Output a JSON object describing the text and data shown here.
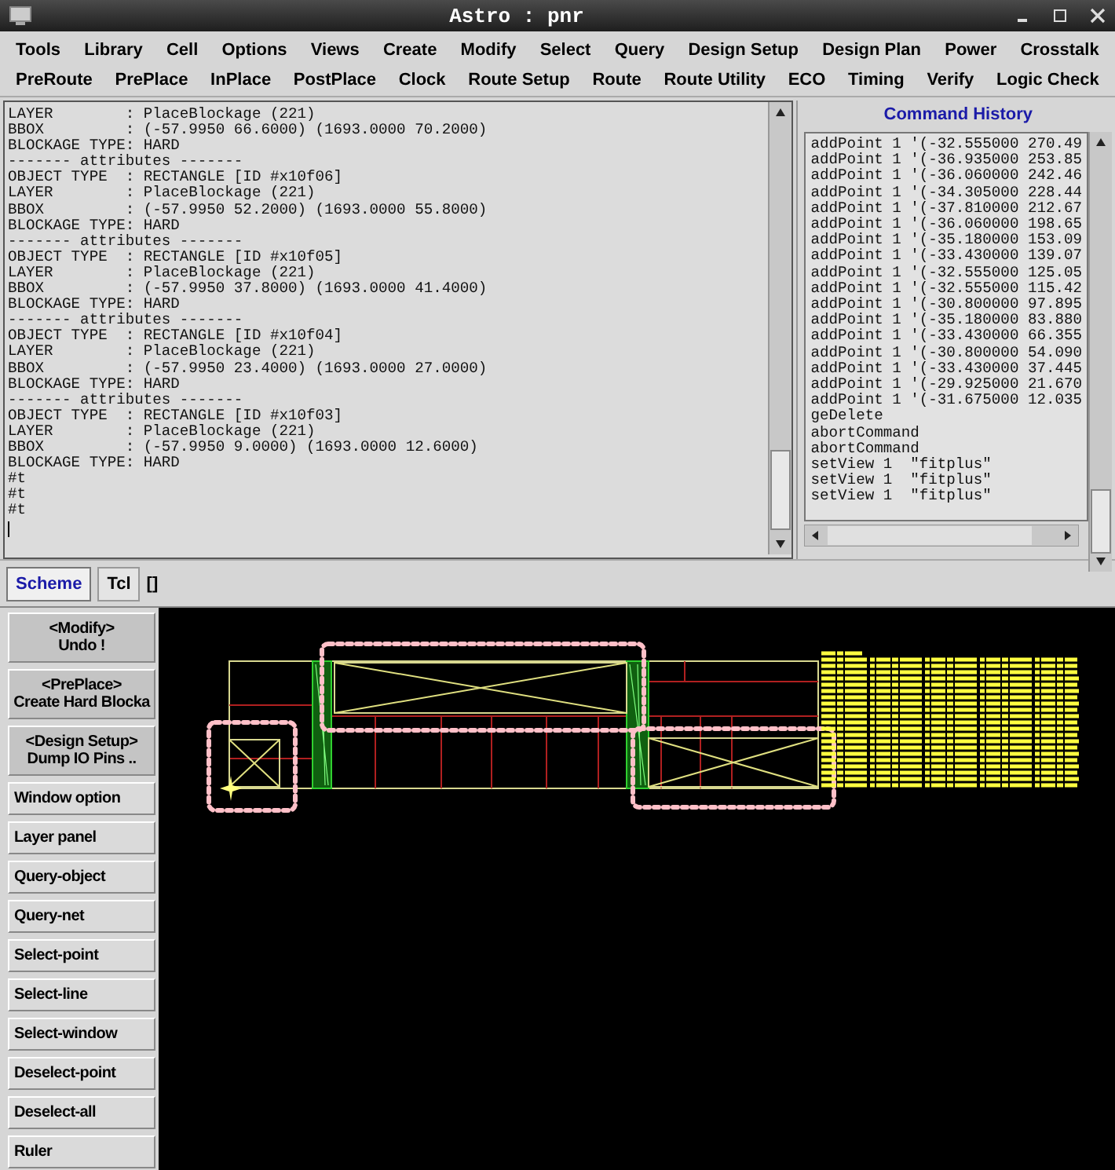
{
  "window": {
    "title": "Astro : pnr"
  },
  "menu_rows": [
    [
      "Tools",
      "Library",
      "Cell",
      "Options",
      "Views",
      "Create",
      "Modify",
      "Select",
      "Query",
      "Design Setup",
      "Design Plan",
      "Power",
      "Crosstalk"
    ],
    [
      "PreRoute",
      "PrePlace",
      "InPlace",
      "PostPlace",
      "Clock",
      "Route Setup",
      "Route",
      "Route Utility",
      "ECO",
      "Timing",
      "Verify",
      "Logic Check"
    ]
  ],
  "console": {
    "lines": [
      "LAYER        : PlaceBlockage (221)",
      "BBOX         : (-57.9950 66.6000) (1693.0000 70.2000)",
      "BLOCKAGE TYPE: HARD",
      "------- attributes -------",
      "OBJECT TYPE  : RECTANGLE [ID #x10f06]",
      "LAYER        : PlaceBlockage (221)",
      "BBOX         : (-57.9950 52.2000) (1693.0000 55.8000)",
      "BLOCKAGE TYPE: HARD",
      "------- attributes -------",
      "OBJECT TYPE  : RECTANGLE [ID #x10f05]",
      "LAYER        : PlaceBlockage (221)",
      "BBOX         : (-57.9950 37.8000) (1693.0000 41.4000)",
      "BLOCKAGE TYPE: HARD",
      "------- attributes -------",
      "OBJECT TYPE  : RECTANGLE [ID #x10f04]",
      "LAYER        : PlaceBlockage (221)",
      "BBOX         : (-57.9950 23.4000) (1693.0000 27.0000)",
      "BLOCKAGE TYPE: HARD",
      "------- attributes -------",
      "OBJECT TYPE  : RECTANGLE [ID #x10f03]",
      "LAYER        : PlaceBlockage (221)",
      "BBOX         : (-57.9950 9.0000) (1693.0000 12.6000)",
      "BLOCKAGE TYPE: HARD",
      "#t",
      "#t",
      "#t"
    ]
  },
  "command_history": {
    "title": "Command History",
    "lines": [
      "addPoint 1 '(-32.555000 270.49",
      "addPoint 1 '(-36.935000 253.85",
      "addPoint 1 '(-36.060000 242.46",
      "addPoint 1 '(-34.305000 228.44",
      "addPoint 1 '(-37.810000 212.67",
      "addPoint 1 '(-36.060000 198.65",
      "addPoint 1 '(-35.180000 153.09",
      "addPoint 1 '(-33.430000 139.07",
      "addPoint 1 '(-32.555000 125.05",
      "addPoint 1 '(-32.555000 115.42",
      "addPoint 1 '(-30.800000 97.895",
      "addPoint 1 '(-35.180000 83.880",
      "addPoint 1 '(-33.430000 66.355",
      "addPoint 1 '(-30.800000 54.090",
      "addPoint 1 '(-33.430000 37.445",
      "addPoint 1 '(-29.925000 21.670",
      "addPoint 1 '(-31.675000 12.035",
      "geDelete",
      "abortCommand",
      "abortCommand",
      "setView 1  \"fitplus\"",
      "setView 1  \"fitplus\"",
      "setView 1  \"fitplus\""
    ]
  },
  "shell_tabs": [
    {
      "label": "Scheme",
      "selected": true
    },
    {
      "label": "Tcl",
      "selected": false
    }
  ],
  "shell_prompt": "[]",
  "tool_buttons": [
    {
      "kind": "recent",
      "context": "<Modify>",
      "label": "Undo !"
    },
    {
      "kind": "recent",
      "context": "<PrePlace>",
      "label": "Create Hard Blocka"
    },
    {
      "kind": "recent",
      "context": "<Design Setup>",
      "label": "Dump IO Pins .."
    },
    {
      "kind": "tool",
      "label": "Window option"
    },
    {
      "kind": "tool",
      "label": "Layer panel"
    },
    {
      "kind": "tool",
      "label": "Query-object"
    },
    {
      "kind": "tool",
      "label": "Query-net"
    },
    {
      "kind": "tool",
      "label": "Select-point"
    },
    {
      "kind": "tool",
      "label": "Select-line"
    },
    {
      "kind": "tool",
      "label": "Select-window"
    },
    {
      "kind": "tool",
      "label": "Deselect-point"
    },
    {
      "kind": "tool",
      "label": "Deselect-all"
    },
    {
      "kind": "tool",
      "label": "Ruler"
    }
  ]
}
